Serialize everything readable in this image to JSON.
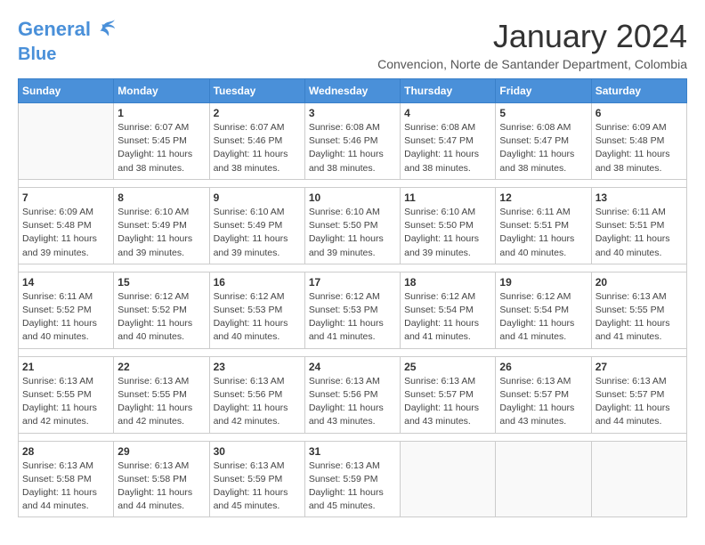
{
  "header": {
    "logo_line1": "General",
    "logo_line2": "Blue",
    "month_title": "January 2024",
    "location": "Convencion, Norte de Santander Department, Colombia"
  },
  "weekdays": [
    "Sunday",
    "Monday",
    "Tuesday",
    "Wednesday",
    "Thursday",
    "Friday",
    "Saturday"
  ],
  "weeks": [
    [
      {
        "day": "",
        "sunrise": "",
        "sunset": "",
        "daylight": ""
      },
      {
        "day": "1",
        "sunrise": "Sunrise: 6:07 AM",
        "sunset": "Sunset: 5:45 PM",
        "daylight": "Daylight: 11 hours and 38 minutes."
      },
      {
        "day": "2",
        "sunrise": "Sunrise: 6:07 AM",
        "sunset": "Sunset: 5:46 PM",
        "daylight": "Daylight: 11 hours and 38 minutes."
      },
      {
        "day": "3",
        "sunrise": "Sunrise: 6:08 AM",
        "sunset": "Sunset: 5:46 PM",
        "daylight": "Daylight: 11 hours and 38 minutes."
      },
      {
        "day": "4",
        "sunrise": "Sunrise: 6:08 AM",
        "sunset": "Sunset: 5:47 PM",
        "daylight": "Daylight: 11 hours and 38 minutes."
      },
      {
        "day": "5",
        "sunrise": "Sunrise: 6:08 AM",
        "sunset": "Sunset: 5:47 PM",
        "daylight": "Daylight: 11 hours and 38 minutes."
      },
      {
        "day": "6",
        "sunrise": "Sunrise: 6:09 AM",
        "sunset": "Sunset: 5:48 PM",
        "daylight": "Daylight: 11 hours and 38 minutes."
      }
    ],
    [
      {
        "day": "7",
        "sunrise": "Sunrise: 6:09 AM",
        "sunset": "Sunset: 5:48 PM",
        "daylight": "Daylight: 11 hours and 39 minutes."
      },
      {
        "day": "8",
        "sunrise": "Sunrise: 6:10 AM",
        "sunset": "Sunset: 5:49 PM",
        "daylight": "Daylight: 11 hours and 39 minutes."
      },
      {
        "day": "9",
        "sunrise": "Sunrise: 6:10 AM",
        "sunset": "Sunset: 5:49 PM",
        "daylight": "Daylight: 11 hours and 39 minutes."
      },
      {
        "day": "10",
        "sunrise": "Sunrise: 6:10 AM",
        "sunset": "Sunset: 5:50 PM",
        "daylight": "Daylight: 11 hours and 39 minutes."
      },
      {
        "day": "11",
        "sunrise": "Sunrise: 6:10 AM",
        "sunset": "Sunset: 5:50 PM",
        "daylight": "Daylight: 11 hours and 39 minutes."
      },
      {
        "day": "12",
        "sunrise": "Sunrise: 6:11 AM",
        "sunset": "Sunset: 5:51 PM",
        "daylight": "Daylight: 11 hours and 40 minutes."
      },
      {
        "day": "13",
        "sunrise": "Sunrise: 6:11 AM",
        "sunset": "Sunset: 5:51 PM",
        "daylight": "Daylight: 11 hours and 40 minutes."
      }
    ],
    [
      {
        "day": "14",
        "sunrise": "Sunrise: 6:11 AM",
        "sunset": "Sunset: 5:52 PM",
        "daylight": "Daylight: 11 hours and 40 minutes."
      },
      {
        "day": "15",
        "sunrise": "Sunrise: 6:12 AM",
        "sunset": "Sunset: 5:52 PM",
        "daylight": "Daylight: 11 hours and 40 minutes."
      },
      {
        "day": "16",
        "sunrise": "Sunrise: 6:12 AM",
        "sunset": "Sunset: 5:53 PM",
        "daylight": "Daylight: 11 hours and 40 minutes."
      },
      {
        "day": "17",
        "sunrise": "Sunrise: 6:12 AM",
        "sunset": "Sunset: 5:53 PM",
        "daylight": "Daylight: 11 hours and 41 minutes."
      },
      {
        "day": "18",
        "sunrise": "Sunrise: 6:12 AM",
        "sunset": "Sunset: 5:54 PM",
        "daylight": "Daylight: 11 hours and 41 minutes."
      },
      {
        "day": "19",
        "sunrise": "Sunrise: 6:12 AM",
        "sunset": "Sunset: 5:54 PM",
        "daylight": "Daylight: 11 hours and 41 minutes."
      },
      {
        "day": "20",
        "sunrise": "Sunrise: 6:13 AM",
        "sunset": "Sunset: 5:55 PM",
        "daylight": "Daylight: 11 hours and 41 minutes."
      }
    ],
    [
      {
        "day": "21",
        "sunrise": "Sunrise: 6:13 AM",
        "sunset": "Sunset: 5:55 PM",
        "daylight": "Daylight: 11 hours and 42 minutes."
      },
      {
        "day": "22",
        "sunrise": "Sunrise: 6:13 AM",
        "sunset": "Sunset: 5:55 PM",
        "daylight": "Daylight: 11 hours and 42 minutes."
      },
      {
        "day": "23",
        "sunrise": "Sunrise: 6:13 AM",
        "sunset": "Sunset: 5:56 PM",
        "daylight": "Daylight: 11 hours and 42 minutes."
      },
      {
        "day": "24",
        "sunrise": "Sunrise: 6:13 AM",
        "sunset": "Sunset: 5:56 PM",
        "daylight": "Daylight: 11 hours and 43 minutes."
      },
      {
        "day": "25",
        "sunrise": "Sunrise: 6:13 AM",
        "sunset": "Sunset: 5:57 PM",
        "daylight": "Daylight: 11 hours and 43 minutes."
      },
      {
        "day": "26",
        "sunrise": "Sunrise: 6:13 AM",
        "sunset": "Sunset: 5:57 PM",
        "daylight": "Daylight: 11 hours and 43 minutes."
      },
      {
        "day": "27",
        "sunrise": "Sunrise: 6:13 AM",
        "sunset": "Sunset: 5:57 PM",
        "daylight": "Daylight: 11 hours and 44 minutes."
      }
    ],
    [
      {
        "day": "28",
        "sunrise": "Sunrise: 6:13 AM",
        "sunset": "Sunset: 5:58 PM",
        "daylight": "Daylight: 11 hours and 44 minutes."
      },
      {
        "day": "29",
        "sunrise": "Sunrise: 6:13 AM",
        "sunset": "Sunset: 5:58 PM",
        "daylight": "Daylight: 11 hours and 44 minutes."
      },
      {
        "day": "30",
        "sunrise": "Sunrise: 6:13 AM",
        "sunset": "Sunset: 5:59 PM",
        "daylight": "Daylight: 11 hours and 45 minutes."
      },
      {
        "day": "31",
        "sunrise": "Sunrise: 6:13 AM",
        "sunset": "Sunset: 5:59 PM",
        "daylight": "Daylight: 11 hours and 45 minutes."
      },
      {
        "day": "",
        "sunrise": "",
        "sunset": "",
        "daylight": ""
      },
      {
        "day": "",
        "sunrise": "",
        "sunset": "",
        "daylight": ""
      },
      {
        "day": "",
        "sunrise": "",
        "sunset": "",
        "daylight": ""
      }
    ]
  ]
}
